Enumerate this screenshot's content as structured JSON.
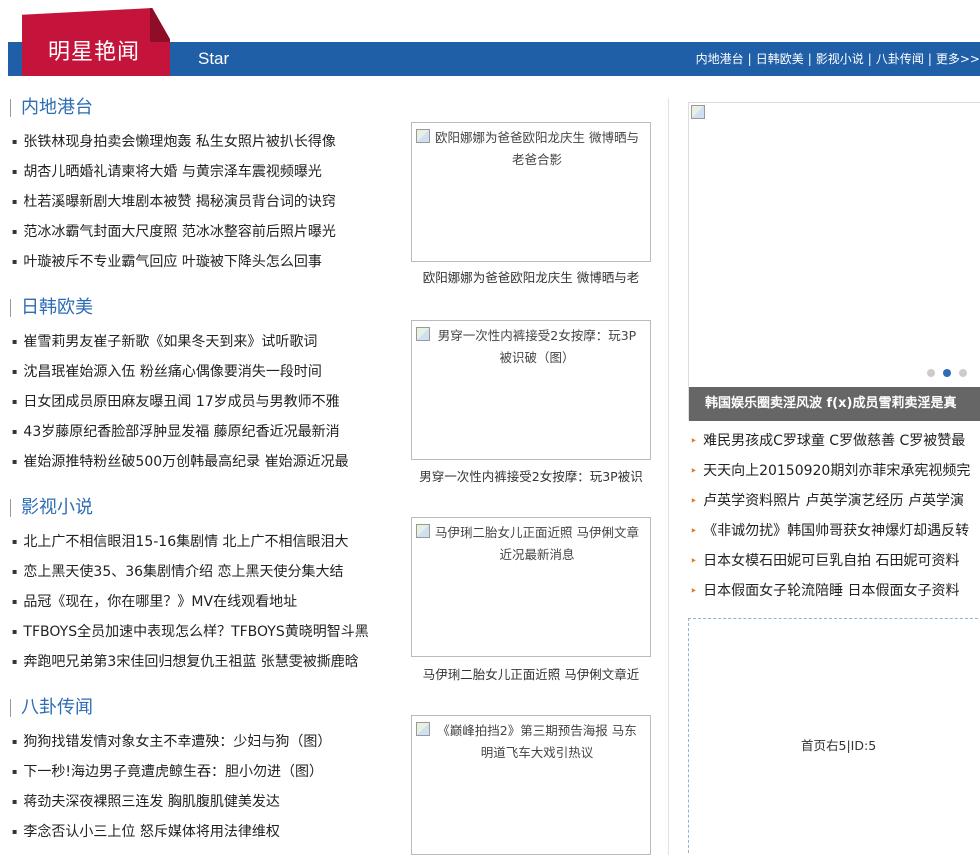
{
  "header": {
    "title_cn": "明星艳闻",
    "title_en": "Star",
    "nav": [
      "内地港台",
      "日韩欧美",
      "影视小说",
      "八卦传闻",
      "更多>>"
    ]
  },
  "sections": [
    {
      "title": "内地港台",
      "items": [
        "张铁林现身拍卖会懒理炮轰 私生女照片被扒长得像",
        "胡杏儿晒婚礼请柬将大婚 与黄宗泽车震视频曝光",
        "杜若溪曝新剧大堆剧本被赞 揭秘演员背台词的诀窍",
        "范冰冰霸气封面大尺度照 范冰冰整容前后照片曝光",
        "叶璇被斥不专业霸气回应 叶璇被下降头怎么回事"
      ],
      "thumb_alt": "欧阳娜娜为爸爸欧阳龙庆生 微博晒与老爸合影",
      "thumb_caption": "欧阳娜娜为爸爸欧阳龙庆生 微博晒与老"
    },
    {
      "title": "日韩欧美",
      "items": [
        "崔雪莉男友崔子新歌《如果冬天到来》试听歌词",
        "沈昌珉崔始源入伍 粉丝痛心偶像要消失一段时间",
        "日女团成员原田麻友曝丑闻 17岁成员与男教师不雅",
        "43岁藤原纪香脸部浮肿显发福 藤原纪香近况最新消",
        "崔始源推特粉丝破500万创韩最高纪录 崔始源近况最"
      ],
      "thumb_alt": "男穿一次性内裤接受2女按摩：玩3P被识破（图）",
      "thumb_caption": "男穿一次性内裤接受2女按摩：玩3P被识"
    },
    {
      "title": "影视小说",
      "items": [
        "北上广不相信眼泪15-16集剧情 北上广不相信眼泪大",
        "恋上黑天使35、36集剧情介绍 恋上黑天使分集大结",
        "品冠《现在，你在哪里？》MV在线观看地址",
        "TFBOYS全员加速中表现怎么样？TFBOYS黄晓明智斗黑",
        "奔跑吧兄弟第3宋佳回归想复仇王祖蓝 张慧雯被撕鹿晗"
      ],
      "thumb_alt": "马伊琍二胎女儿正面近照 马伊俐文章近况最新消息",
      "thumb_caption": "马伊琍二胎女儿正面近照 马伊俐文章近"
    },
    {
      "title": "八卦传闻",
      "items": [
        "狗狗找错发情对象女主不幸遭殃：少妇与狗（图）",
        "下一秒!海边男子竟遭虎鲸生吞：胆小勿进（图）",
        "蒋劲夫深夜裸照三连发 胸肌腹肌健美发达",
        "李念否认小三上位 怒斥媒体将用法律维权"
      ],
      "thumb_alt": "《巅峰拍挡2》第三期预告海报 马东明道飞车大戏引热议",
      "thumb_caption": ""
    }
  ],
  "slider": {
    "caption": "韩国娱乐圈卖淫风波 f(x)成员雪莉卖淫是真",
    "dots": 3,
    "active_dot": 2
  },
  "right_list": [
    "难民男孩成C罗球童 C罗做慈善 C罗被赞最",
    "天天向上20150920期刘亦菲宋承宪视频完",
    "卢英学资料照片 卢英学演艺经历 卢英学演",
    "《非诚勿扰》韩国帅哥获女神爆灯却遇反转",
    "日本女模石田妮可巨乳自拍 石田妮可资料",
    "日本假面女子轮流陪睡 日本假面女子资料"
  ],
  "ad": {
    "label": "首页右5|ID:5"
  }
}
